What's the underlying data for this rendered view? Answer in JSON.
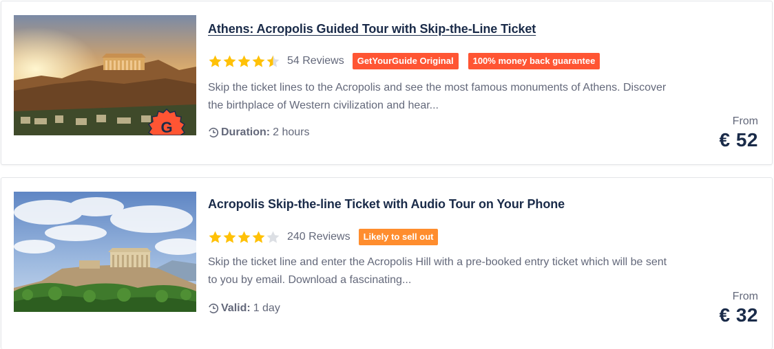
{
  "listings": [
    {
      "title": "Athens: Acropolis Guided Tour with Skip-the-Line Ticket",
      "rating": 4.5,
      "reviews": "54 Reviews",
      "badges": [
        {
          "label": "GetYourGuide Original",
          "color": "#ff5533"
        },
        {
          "label": "100% money back guarantee",
          "color": "#ff5533"
        }
      ],
      "description_line1": "Skip the ticket lines to the Acropolis and see the most famous monuments of Athens. Discover",
      "description_line2": "the birthplace of Western civilization and hear...",
      "meta_label": "Duration:",
      "meta_value": "2 hours",
      "price_prefix": "From",
      "price": "€ 52",
      "image_badge": "G",
      "meta_icon": "clock-icon"
    },
    {
      "title": "Acropolis Skip-the-line Ticket with Audio Tour on Your Phone",
      "rating": 4,
      "reviews": "240 Reviews",
      "badges": [
        {
          "label": "Likely to sell out",
          "color": "#ff8d2e"
        }
      ],
      "description_line1": "Skip the ticket line and enter the Acropolis Hill with a pre-booked entry ticket which will be sent",
      "description_line2": "to you by email. Download a fascinating...",
      "meta_label": "Valid:",
      "meta_value": "1 day",
      "price_prefix": "From",
      "price": "€ 32",
      "meta_icon": "clock-icon"
    }
  ],
  "colors": {
    "text_dark": "#1a2b49",
    "text_muted": "#63687a",
    "star": "#ffc107",
    "star_empty": "#dcdfe4",
    "badge_red": "#ff5533",
    "badge_orange": "#ff8d2e"
  }
}
